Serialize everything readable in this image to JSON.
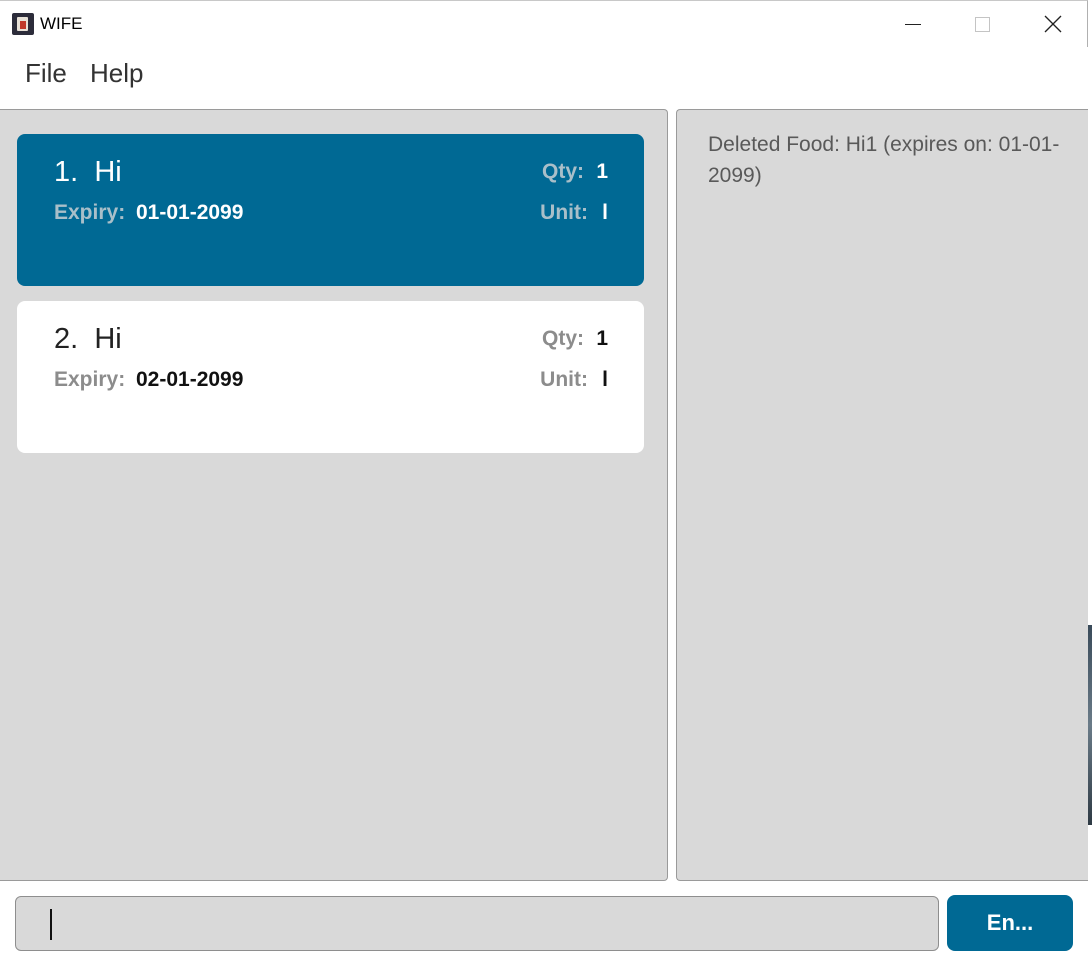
{
  "window": {
    "title": "WIFE",
    "app_icon": "app-logo-icon",
    "controls": {
      "minimize_icon": "minimize-icon",
      "maximize_icon": "maximize-icon",
      "close_icon": "close-icon"
    }
  },
  "menu": {
    "items": [
      {
        "label": "File"
      },
      {
        "label": "Help"
      }
    ]
  },
  "food_list": [
    {
      "index": "1.",
      "name": "Hi",
      "expiry_label": "Expiry:",
      "expiry": "01-01-2099",
      "qty_label": "Qty:",
      "qty": "1",
      "unit_label": "Unit:",
      "unit": "l",
      "selected": true
    },
    {
      "index": "2.",
      "name": "Hi",
      "expiry_label": "Expiry:",
      "expiry": "02-01-2099",
      "qty_label": "Qty:",
      "qty": "1",
      "unit_label": "Unit:",
      "unit": "l",
      "selected": false
    }
  ],
  "result": {
    "message": "Deleted Food: Hi1 (expires on: 01-01-2099)"
  },
  "command": {
    "value": "",
    "enter_label": "En..."
  },
  "colors": {
    "accent": "#006994",
    "panel_bg": "#d9d9d9",
    "card_bg": "#ffffff"
  }
}
